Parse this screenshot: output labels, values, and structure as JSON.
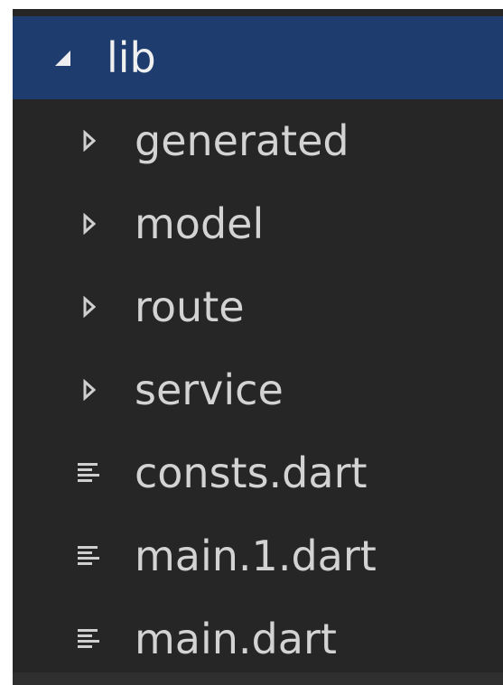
{
  "tree": {
    "root": {
      "label": "lib",
      "expanded": true,
      "icon": "triangle-expanded-icon"
    },
    "items": [
      {
        "label": "generated",
        "type": "folder",
        "icon": "triangle-collapsed-icon"
      },
      {
        "label": "model",
        "type": "folder",
        "icon": "triangle-collapsed-icon"
      },
      {
        "label": "route",
        "type": "folder",
        "icon": "triangle-collapsed-icon"
      },
      {
        "label": "service",
        "type": "folder",
        "icon": "triangle-collapsed-icon"
      },
      {
        "label": "consts.dart",
        "type": "file",
        "icon": "file-lines-icon"
      },
      {
        "label": "main.1.dart",
        "type": "file",
        "icon": "file-lines-icon"
      },
      {
        "label": "main.dart",
        "type": "file",
        "icon": "file-lines-icon"
      }
    ]
  },
  "colors": {
    "panel_background": "#262626",
    "selection_background": "#1e3d6e",
    "text": "#d3d3d3",
    "icon": "#cfcfcf"
  }
}
